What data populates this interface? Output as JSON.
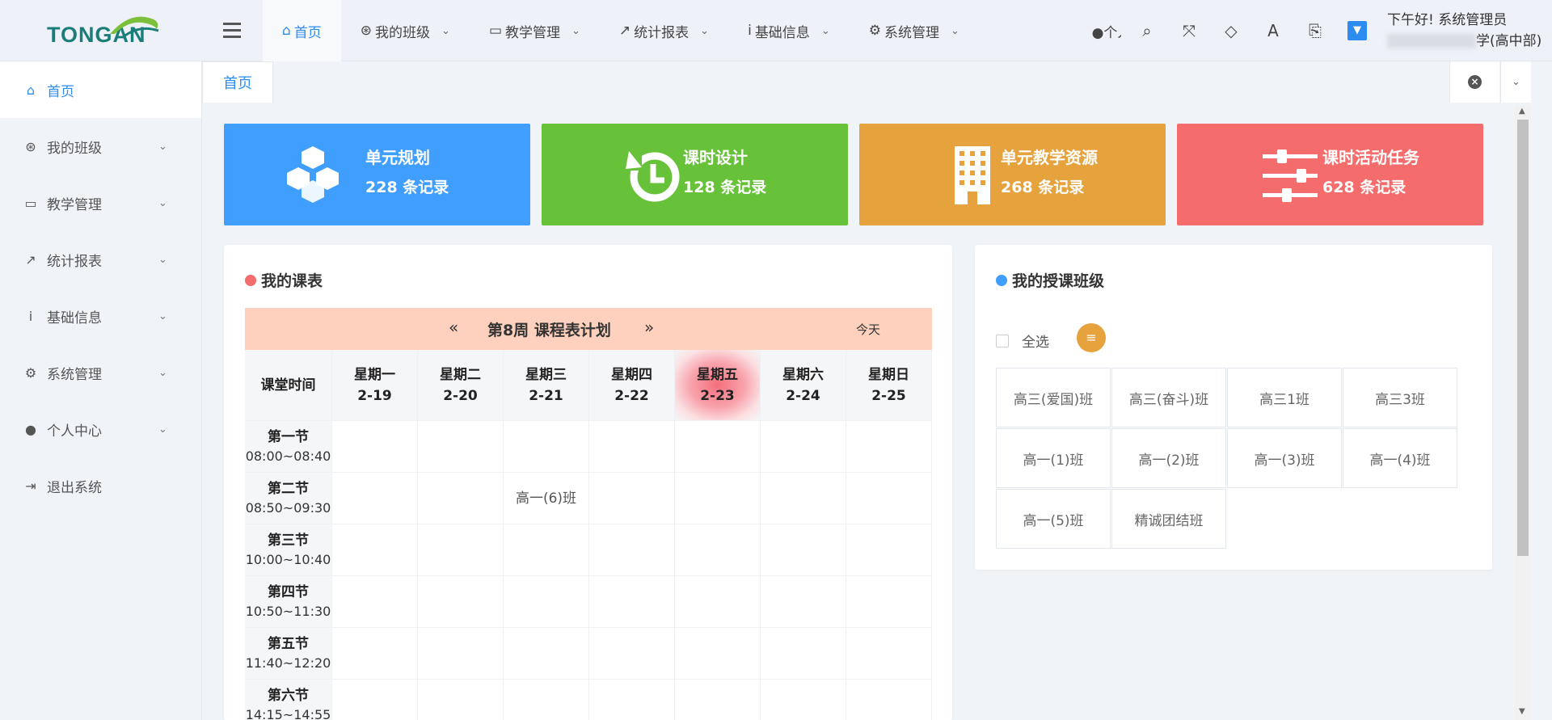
{
  "brand": {
    "logo_text": "TONGAN"
  },
  "nav": [
    {
      "label": "首页",
      "icon": "home-icon",
      "glyph": "⌂",
      "active": true
    },
    {
      "label": "我的班级",
      "icon": "basketball-icon",
      "glyph": "⊛"
    },
    {
      "label": "教学管理",
      "icon": "monitor-icon",
      "glyph": "▭"
    },
    {
      "label": "统计报表",
      "icon": "line-chart-icon",
      "glyph": "↗"
    },
    {
      "label": "基础信息",
      "icon": "info-icon",
      "glyph": "i"
    },
    {
      "label": "系统管理",
      "icon": "gears-icon",
      "glyph": "⚙"
    }
  ],
  "tools": {
    "personal_label": "个人",
    "search_glyph": "⌕",
    "fullscreen_glyph": "⤧",
    "theme_glyph": "◇",
    "font_glyph": "A",
    "translate_glyph": "⎘",
    "box_glyph": "▼"
  },
  "user": {
    "greeting": "下午好!",
    "name": "系统管理员",
    "org_suffix": "学(高中部)"
  },
  "sidebar": [
    {
      "label": "首页",
      "glyph": "⌂",
      "active": true
    },
    {
      "label": "我的班级",
      "glyph": "⊛"
    },
    {
      "label": "教学管理",
      "glyph": "▭"
    },
    {
      "label": "统计报表",
      "glyph": "↗"
    },
    {
      "label": "基础信息",
      "glyph": "i"
    },
    {
      "label": "系统管理",
      "glyph": "⚙"
    },
    {
      "label": "个人中心",
      "glyph": "●"
    },
    {
      "label": "退出系统",
      "glyph": "⇥"
    }
  ],
  "tabs": {
    "active": "首页",
    "close_glyph": "×",
    "more_glyph": "⌄"
  },
  "stats": [
    {
      "title": "单元规划",
      "count": "228 条记录",
      "color": "#409eff"
    },
    {
      "title": "课时设计",
      "count": "128 条记录",
      "color": "#67c23a"
    },
    {
      "title": "单元教学资源",
      "count": "268 条记录",
      "color": "#e6a23c"
    },
    {
      "title": "课时活动任务",
      "count": "628 条记录",
      "color": "#f56c6c"
    }
  ],
  "schedule": {
    "title": "我的课表",
    "dot_color": "#f56c6c",
    "week_title": "第8周 课程表计划",
    "prev": "«",
    "next": "»",
    "today": "今天",
    "time_header": "课堂时间",
    "days": [
      {
        "name": "星期一",
        "date": "2-19"
      },
      {
        "name": "星期二",
        "date": "2-20"
      },
      {
        "name": "星期三",
        "date": "2-21"
      },
      {
        "name": "星期四",
        "date": "2-22"
      },
      {
        "name": "星期五",
        "date": "2-23",
        "today": true
      },
      {
        "name": "星期六",
        "date": "2-24"
      },
      {
        "name": "星期日",
        "date": "2-25"
      }
    ],
    "periods": [
      {
        "name": "第一节",
        "time": "08:00~08:40",
        "cells": [
          "",
          "",
          "",
          "",
          "",
          "",
          ""
        ]
      },
      {
        "name": "第二节",
        "time": "08:50~09:30",
        "cells": [
          "",
          "",
          "高一(6)班",
          "",
          "",
          "",
          ""
        ]
      },
      {
        "name": "第三节",
        "time": "10:00~10:40",
        "cells": [
          "",
          "",
          "",
          "",
          "",
          "",
          ""
        ]
      },
      {
        "name": "第四节",
        "time": "10:50~11:30",
        "cells": [
          "",
          "",
          "",
          "",
          "",
          "",
          ""
        ]
      },
      {
        "name": "第五节",
        "time": "11:40~12:20",
        "cells": [
          "",
          "",
          "",
          "",
          "",
          "",
          ""
        ]
      },
      {
        "name": "第六节",
        "time": "14:15~14:55",
        "cells": [
          "",
          "",
          "",
          "",
          "",
          "",
          ""
        ]
      }
    ]
  },
  "classes": {
    "title": "我的授课班级",
    "dot_color": "#409eff",
    "select_all": "全选",
    "list_glyph": "≡",
    "items": [
      "高三(爱国)班",
      "高三(奋斗)班",
      "高三1班",
      "高三3班",
      "高一(1)班",
      "高一(2)班",
      "高一(3)班",
      "高一(4)班",
      "高一(5)班",
      "精诚团结班"
    ]
  }
}
